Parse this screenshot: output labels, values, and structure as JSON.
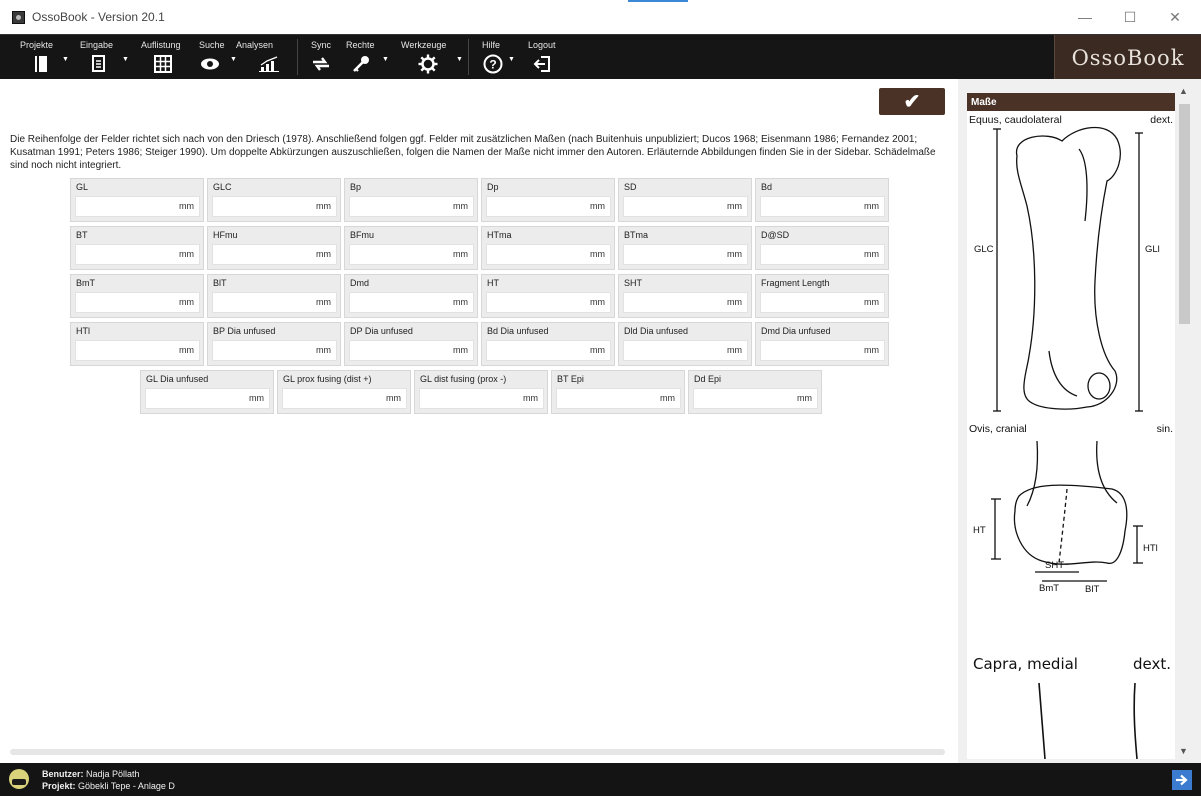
{
  "window": {
    "title": "OssoBook - Version 20.1",
    "minimize_glyph": "—",
    "maximize_glyph": "☐",
    "close_glyph": "✕"
  },
  "toolbar": {
    "items": [
      {
        "label": "Projekte",
        "icon": "notebook-icon",
        "glyph": "▮",
        "dropdown": true
      },
      {
        "label": "Eingabe",
        "icon": "document-edit-icon",
        "glyph": "▤",
        "dropdown": true
      },
      {
        "label": "Auflistung",
        "icon": "table-grid-icon",
        "glyph": "▦",
        "dropdown": false
      },
      {
        "label": "Suche",
        "icon": "eye-icon",
        "glyph": "◉",
        "dropdown": true
      },
      {
        "label": "Analysen",
        "icon": "chart-icon",
        "glyph": "📶",
        "dropdown": false
      },
      {
        "label": "Sync",
        "icon": "sync-arrows-icon",
        "glyph": "⇄",
        "dropdown": false
      },
      {
        "label": "Rechte",
        "icon": "key-icon",
        "glyph": "⚷",
        "dropdown": true
      },
      {
        "label": "Werkzeuge",
        "icon": "gear-icon",
        "glyph": "⚙",
        "dropdown": true
      },
      {
        "label": "Hilfe",
        "icon": "help-icon",
        "glyph": "?",
        "dropdown": true
      },
      {
        "label": "Logout",
        "icon": "logout-icon",
        "glyph": "⇦",
        "dropdown": false
      }
    ],
    "logo": "OssoBook"
  },
  "main": {
    "confirm_glyph": "✔",
    "intro": "Die Reihenfolge der Felder richtet sich nach von den Driesch (1978). Anschließend folgen ggf. Felder mit zusätzlichen Maßen (nach Buitenhuis unpubliziert; Ducos 1968; Eisenmann 1986; Fernandez 2001; Kusatman 1991; Peters 1986; Steiger 1990). Um doppelte Abkürzungen auszuschließen, folgen die Namen der Maße nicht immer den Autoren. Erläuternde Abbildungen finden Sie in der Sidebar. Schädelmaße sind noch nicht integriert.",
    "unit": "mm",
    "rows": [
      [
        "GL",
        "GLC",
        "Bp",
        "Dp",
        "SD",
        "Bd"
      ],
      [
        "BT",
        "HFmu",
        "BFmu",
        "HTma",
        "BTma",
        "D@SD"
      ],
      [
        "BmT",
        "BlT",
        "Dmd",
        "HT",
        "SHT",
        "Fragment Length"
      ],
      [
        "HTl",
        "BP Dia unfused",
        "DP Dia unfused",
        "Bd Dia unfused",
        "Dld Dia unfused",
        "Dmd Dia unfused"
      ],
      [
        "GL Dia unfused",
        "GL prox fusing (dist +)",
        "GL dist fusing (prox -)",
        "BT Epi",
        "Dd Epi"
      ]
    ],
    "values": {}
  },
  "sidebar": {
    "header": "Maße",
    "figures": [
      {
        "caption": "Equus, caudolateral",
        "side": "dext.",
        "labels": [
          "GLC",
          "GLl"
        ]
      },
      {
        "caption": "Ovis, cranial",
        "side": "sin.",
        "labels": [
          "HT",
          "HTl",
          "SHT",
          "BmT",
          "BlT"
        ]
      },
      {
        "caption": "Capra, medial",
        "side": "dext."
      }
    ]
  },
  "status": {
    "user_label": "Benutzer:",
    "user_value": "Nadja Pöllath",
    "project_label": "Projekt:",
    "project_value": "Göbekli Tepe - Anlage D"
  }
}
